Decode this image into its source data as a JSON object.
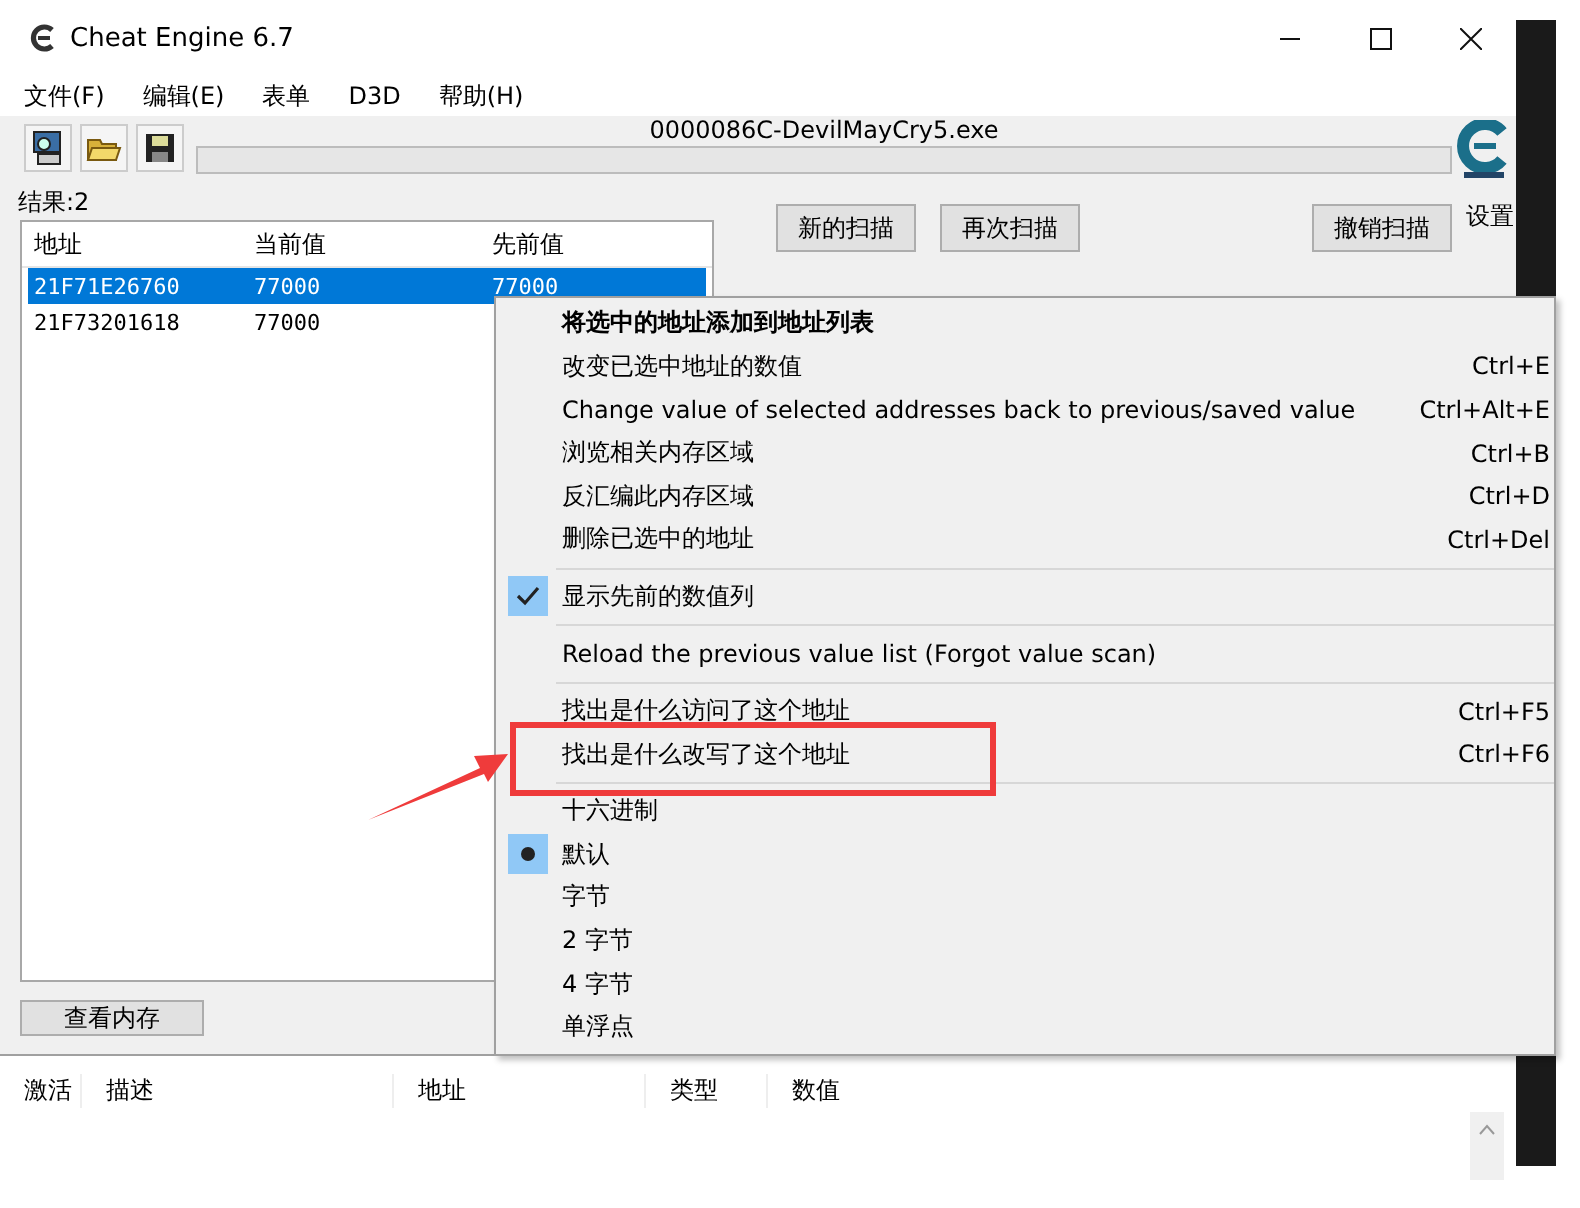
{
  "window": {
    "title": "Cheat Engine 6.7"
  },
  "menu_bar": [
    "文件(F)",
    "编辑(E)",
    "表单",
    "D3D",
    "帮助(H)"
  ],
  "process": "0000086C-DevilMayCry5.exe",
  "scan_progress": {
    "level": 0
  },
  "settings_label": "设置",
  "result_count": "结果:2",
  "results": {
    "columns": [
      "地址",
      "当前值",
      "先前值"
    ],
    "rows": [
      {
        "cells": [
          "21F71E26760",
          "77000",
          "77000"
        ],
        "selected": true
      },
      {
        "cells": [
          "21F73201618",
          "77000"
        ],
        "selected": false
      }
    ]
  },
  "scan_buttons": [
    "新的扫描",
    "再次扫描",
    "撤销扫描"
  ],
  "view_memory_button": "查看内存",
  "address_list": {
    "columns": [
      "激活",
      "描述",
      "地址",
      "类型",
      "数值"
    ]
  },
  "context_menu": {
    "items": [
      {
        "kind": "item",
        "label": "将选中的地址添加到地址列表",
        "default": true
      },
      {
        "kind": "item",
        "label": "改变已选中地址的数值",
        "shortcut": "Ctrl+E"
      },
      {
        "kind": "item",
        "label": "Change value of selected addresses back to previous/saved value",
        "shortcut": "Ctrl+Alt+E"
      },
      {
        "kind": "item",
        "label": "浏览相关内存区域",
        "shortcut": "Ctrl+B"
      },
      {
        "kind": "item",
        "label": "反汇编此内存区域",
        "shortcut": "Ctrl+D"
      },
      {
        "kind": "item",
        "label": "删除已选中的地址",
        "shortcut": "Ctrl+Del"
      },
      {
        "kind": "separator"
      },
      {
        "kind": "check",
        "label": "显示先前的数值列",
        "checked": true
      },
      {
        "kind": "separator"
      },
      {
        "kind": "item",
        "label": "Reload the previous value list (Forgot value scan)"
      },
      {
        "kind": "separator"
      },
      {
        "kind": "item",
        "label": "找出是什么访问了这个地址",
        "shortcut": "Ctrl+F5"
      },
      {
        "kind": "item",
        "label": "找出是什么改写了这个地址",
        "shortcut": "Ctrl+F6"
      },
      {
        "kind": "separator"
      },
      {
        "kind": "check",
        "label": "十六进制",
        "checked": false
      },
      {
        "kind": "radio",
        "label": "默认",
        "selected": true
      },
      {
        "kind": "radio",
        "label": "字节",
        "selected": false
      },
      {
        "kind": "radio",
        "label": "2 字节",
        "selected": false
      },
      {
        "kind": "radio",
        "label": "4 字节",
        "selected": false
      },
      {
        "kind": "radio",
        "label": "单浮点",
        "selected": false
      }
    ]
  }
}
